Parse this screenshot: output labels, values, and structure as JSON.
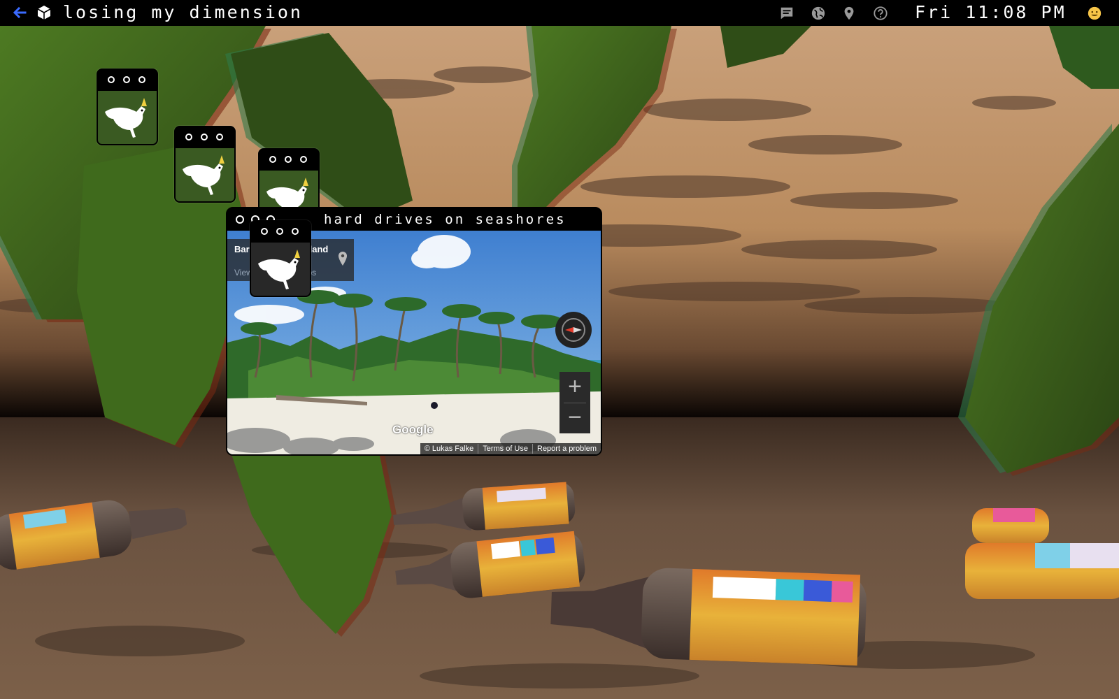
{
  "topbar": {
    "title": "losing my dimension",
    "clock": "Fri 11:08 PM",
    "back_icon": "back-arrow-icon",
    "logo_icon": "cube-icon",
    "icons": [
      "chat-icon",
      "globe-icon",
      "map-pin-icon",
      "help-icon",
      "smiley-icon"
    ]
  },
  "main_window": {
    "title": "hard drives on seashores",
    "streetview": {
      "place_name": "Barefoot Kuata Island",
      "view_link": "View on Google Maps",
      "logo": "Google",
      "copyright": "© Lukas Falke",
      "terms": "Terms of Use",
      "report": "Report a problem",
      "zoom_in": "+",
      "zoom_out": "−"
    }
  },
  "mini_windows": [
    {
      "content": "cockatoo-bird"
    },
    {
      "content": "cockatoo-bird"
    },
    {
      "content": "cockatoo-bird"
    },
    {
      "content": "cockatoo-bird"
    }
  ],
  "colors": {
    "sky": "#c7996a",
    "leaf": "#3b5b1e",
    "bar": "#000000",
    "accent_blue": "#3b6bff"
  }
}
